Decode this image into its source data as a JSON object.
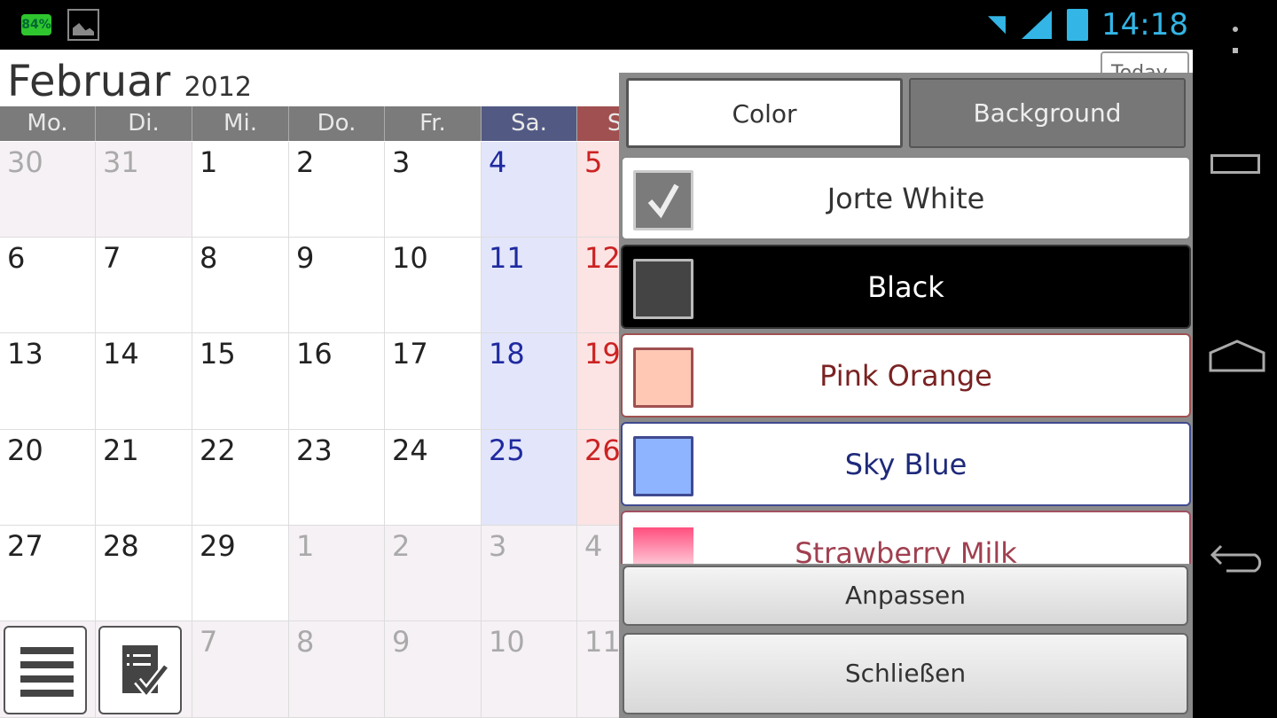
{
  "status": {
    "battery_small": "84%",
    "time": "14:18"
  },
  "calendar": {
    "month": "Februar",
    "year": "2012",
    "today_label": "Today",
    "weekdays": [
      "Mo.",
      "Di.",
      "Mi.",
      "Do.",
      "Fr.",
      "Sa.",
      "So."
    ],
    "weeks": [
      [
        "30",
        "31",
        "1",
        "2",
        "3",
        "4",
        "5"
      ],
      [
        "6",
        "7",
        "8",
        "9",
        "10",
        "11",
        "12"
      ],
      [
        "13",
        "14",
        "15",
        "16",
        "17",
        "18",
        "19"
      ],
      [
        "20",
        "21",
        "22",
        "23",
        "24",
        "25",
        "26"
      ],
      [
        "27",
        "28",
        "29",
        "1",
        "2",
        "3",
        "4"
      ],
      [
        "5",
        "6",
        "7",
        "8",
        "9",
        "10",
        "11"
      ]
    ],
    "in_month": [
      [
        false,
        false,
        true,
        true,
        true,
        true,
        true
      ],
      [
        true,
        true,
        true,
        true,
        true,
        true,
        true
      ],
      [
        true,
        true,
        true,
        true,
        true,
        true,
        true
      ],
      [
        true,
        true,
        true,
        true,
        true,
        true,
        true
      ],
      [
        true,
        true,
        true,
        false,
        false,
        false,
        false
      ],
      [
        false,
        false,
        false,
        false,
        false,
        false,
        false
      ]
    ]
  },
  "panel": {
    "tabs": [
      {
        "label": "Color",
        "active": true
      },
      {
        "label": "Background",
        "active": false
      }
    ],
    "items": [
      {
        "label": "Jorte White",
        "selected": true,
        "swatch": "#7b7b7b",
        "bg": "#ffffff",
        "fg": "#333333",
        "border": "#888888"
      },
      {
        "label": "Black",
        "selected": false,
        "swatch": "#444444",
        "bg": "#000000",
        "fg": "#ffffff",
        "border": "#333333"
      },
      {
        "label": "Pink Orange",
        "selected": false,
        "swatch": "#ffc8b4",
        "bg": "#ffffff",
        "fg": "#7a2222",
        "border": "#a05050"
      },
      {
        "label": "Sky Blue",
        "selected": false,
        "swatch": "#8fb4ff",
        "bg": "#ffffff",
        "fg": "#1e2a7a",
        "border": "#404a90"
      },
      {
        "label": "Strawberry Milk",
        "selected": false,
        "swatch": "#ff4f7f",
        "bg": "#ffffff",
        "fg": "#a04050",
        "border": "#a05060"
      }
    ],
    "customize_label": "Anpassen",
    "close_label": "Schließen"
  },
  "colors": {
    "sat_header": "#525a84",
    "sun_header": "#a05050",
    "sat_bg": "#e3e6fa",
    "sun_bg": "#fce4e4",
    "other_month_bg": "#f6f1f5",
    "sat_text": "#1f2aa0",
    "sun_text": "#cc2222"
  }
}
